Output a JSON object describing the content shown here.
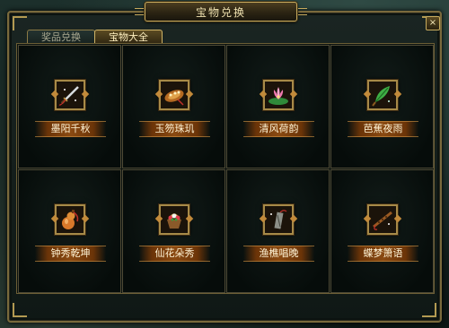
{
  "window": {
    "title": "宝物兑换",
    "close_label": "×"
  },
  "tabs": [
    {
      "label": "奖品兑换",
      "active": false
    },
    {
      "label": "宝物大全",
      "active": true
    }
  ],
  "items": [
    {
      "name": "墨阳千秋",
      "icon": "sword-icon"
    },
    {
      "name": "玉笏珠玑",
      "icon": "jade-tablet-icon"
    },
    {
      "name": "清风荷韵",
      "icon": "lotus-icon"
    },
    {
      "name": "芭蕉夜雨",
      "icon": "banana-leaf-fan-icon"
    },
    {
      "name": "钟秀乾坤",
      "icon": "gourd-icon"
    },
    {
      "name": "仙花朵秀",
      "icon": "flower-basket-icon"
    },
    {
      "name": "渔樵唱晚",
      "icon": "bamboo-slip-icon"
    },
    {
      "name": "蝶梦箫语",
      "icon": "flute-icon"
    }
  ],
  "colors": {
    "accent_gold": "#c6a95c",
    "plate_brown": "#8a4a12",
    "text_cream": "#fff4d6"
  }
}
